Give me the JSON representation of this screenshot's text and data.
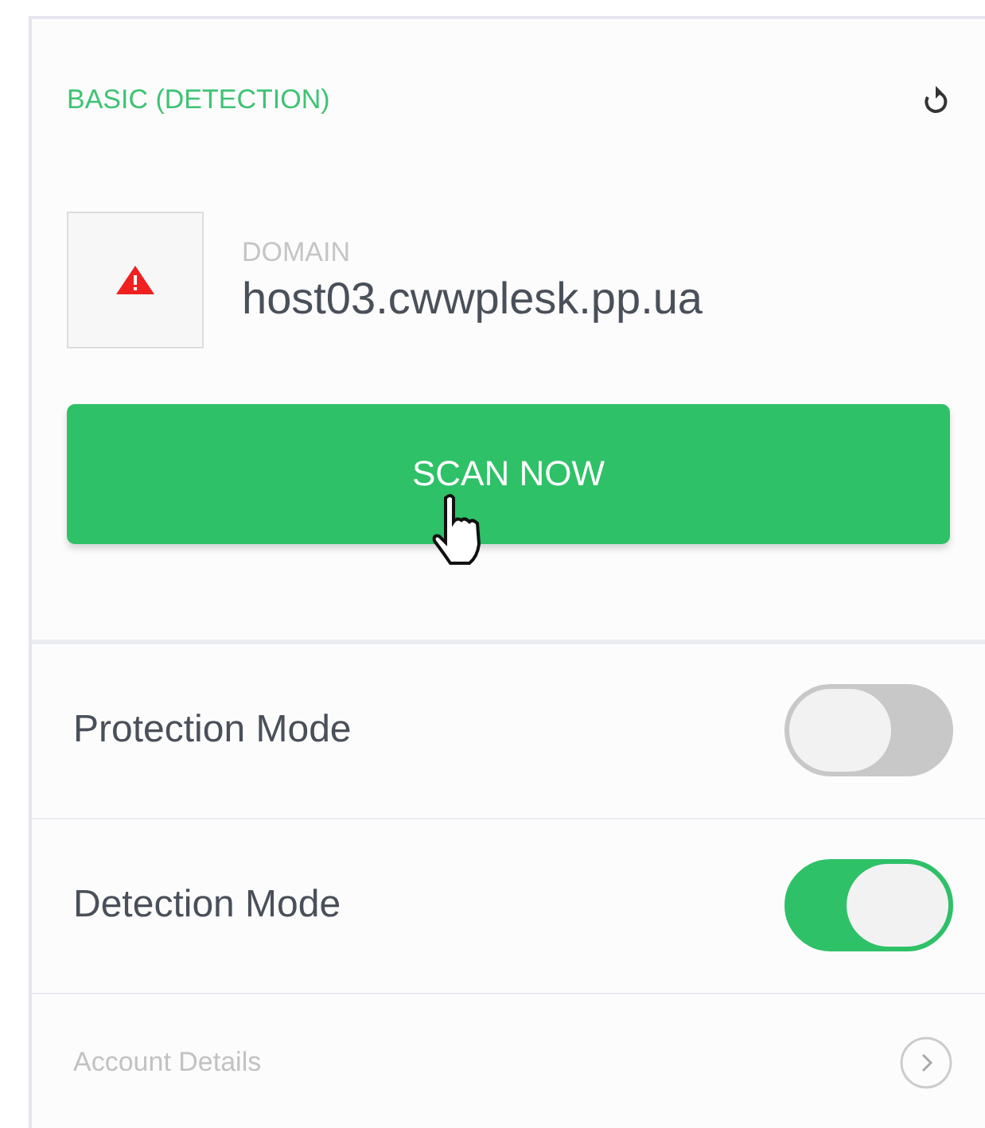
{
  "card": {
    "title": "BASIC (DETECTION)",
    "domain": {
      "label": "DOMAIN",
      "value": "host03.cwwplesk.pp.ua",
      "warning": true
    },
    "scan_button": {
      "label": "SCAN NOW"
    }
  },
  "settings": [
    {
      "kind": "toggle",
      "label": "Protection Mode",
      "on": false
    },
    {
      "kind": "toggle",
      "label": "Detection Mode",
      "on": true
    },
    {
      "kind": "link",
      "label": "Account Details"
    }
  ]
}
